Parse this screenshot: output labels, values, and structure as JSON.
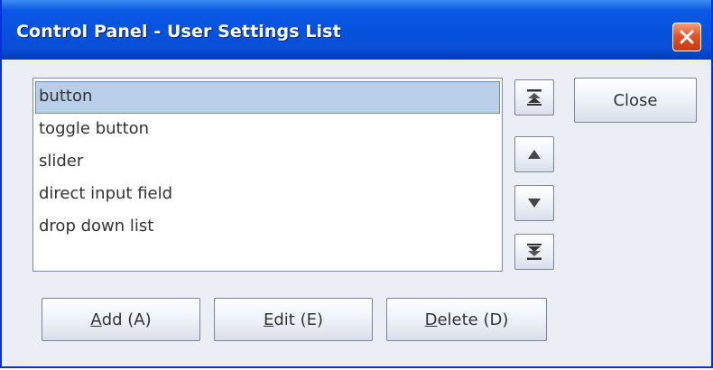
{
  "window": {
    "title": "Control Panel - User Settings List"
  },
  "list": {
    "items": [
      {
        "label": "button",
        "selected": true
      },
      {
        "label": "toggle button",
        "selected": false
      },
      {
        "label": "slider",
        "selected": false
      },
      {
        "label": "direct input field",
        "selected": false
      },
      {
        "label": "drop down list",
        "selected": false
      }
    ]
  },
  "side_buttons": {
    "close_label": "Close"
  },
  "order_buttons": {
    "icons": [
      "move-to-top-icon",
      "move-up-icon",
      "move-down-icon",
      "move-to-bottom-icon"
    ]
  },
  "bottom_buttons": {
    "add": {
      "mnemonic": "A",
      "rest": "dd (A)"
    },
    "edit": {
      "mnemonic": "E",
      "rest": "dit (E)"
    },
    "delete": {
      "mnemonic": "D",
      "rest": "elete (D)"
    }
  },
  "colors": {
    "title_bar": "#0552de",
    "selection": "#b9cfe9",
    "close_button": "#e2542c"
  }
}
